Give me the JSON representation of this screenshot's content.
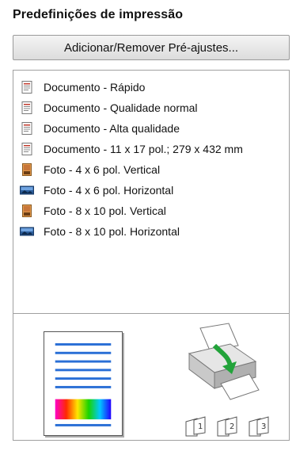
{
  "title": "Predefinições de impressão",
  "add_remove_button": "Adicionar/Remover Pré-ajustes...",
  "presets": [
    {
      "label": "Documento - Rápido",
      "icon": "document-icon"
    },
    {
      "label": "Documento - Qualidade normal",
      "icon": "document-icon"
    },
    {
      "label": "Documento - Alta qualidade",
      "icon": "document-icon"
    },
    {
      "label": "Documento - 11 x 17 pol.; 279 x 432 mm",
      "icon": "document-icon"
    },
    {
      "label": "Foto - 4 x 6 pol. Vertical",
      "icon": "photo-portrait-icon"
    },
    {
      "label": "Foto - 4 x 6 pol. Horizontal",
      "icon": "photo-landscape-icon"
    },
    {
      "label": "Foto - 8 x 10 pol. Vertical",
      "icon": "photo-portrait-icon"
    },
    {
      "label": "Foto - 8 x 10 pol. Horizontal",
      "icon": "photo-landscape-icon"
    }
  ],
  "preview": {
    "page_icon": "page-preview-icon",
    "printer_icon": "printer-icon",
    "copy_numbers": [
      "1",
      "2",
      "3"
    ]
  },
  "colors": {
    "line_blue": "#2a6fd6",
    "arrow_green": "#22a33a",
    "border": "#a0a0a0"
  }
}
